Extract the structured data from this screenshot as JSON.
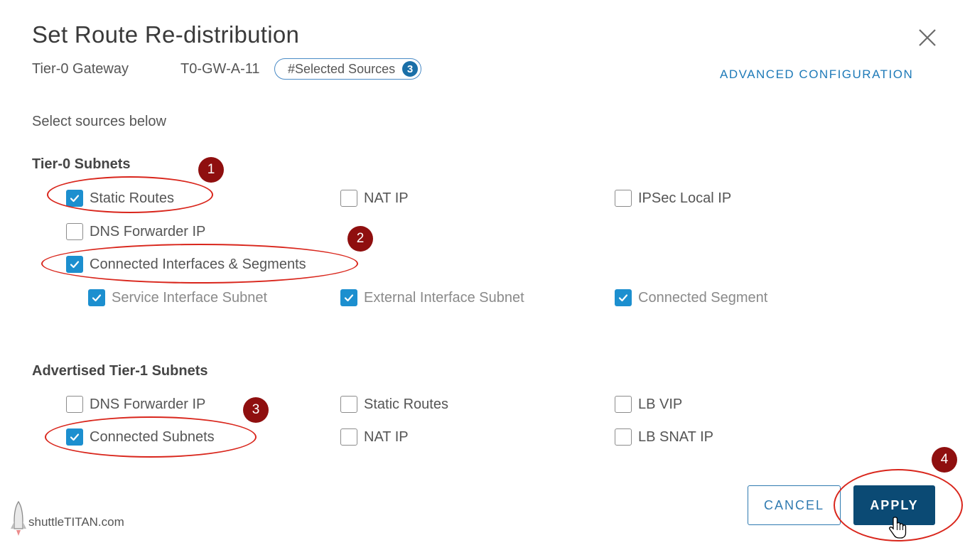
{
  "dialog": {
    "title": "Set Route Re-distribution",
    "gateway_label": "Tier-0 Gateway",
    "gateway_name": "T0-GW-A-11",
    "selected_sources_label": "#Selected Sources",
    "selected_sources_count": "3",
    "advanced_configuration": "ADVANCED CONFIGURATION",
    "hint": "Select sources below"
  },
  "tier0": {
    "heading": "Tier-0 Subnets",
    "static_routes": {
      "label": "Static Routes",
      "checked": true
    },
    "nat_ip": {
      "label": "NAT IP",
      "checked": false
    },
    "ipsec_local_ip": {
      "label": "IPSec Local IP",
      "checked": false
    },
    "dns_forwarder_ip": {
      "label": "DNS Forwarder IP",
      "checked": false
    },
    "connected_interfaces": {
      "label": "Connected Interfaces & Segments",
      "checked": true
    },
    "service_interface_subnet": {
      "label": "Service Interface Subnet",
      "checked": true
    },
    "external_interface_subnet": {
      "label": "External Interface Subnet",
      "checked": true
    },
    "connected_segment": {
      "label": "Connected Segment",
      "checked": true
    }
  },
  "tier1": {
    "heading": "Advertised Tier-1 Subnets",
    "dns_forwarder_ip": {
      "label": "DNS Forwarder IP",
      "checked": false
    },
    "static_routes": {
      "label": "Static Routes",
      "checked": false
    },
    "lb_vip": {
      "label": "LB VIP",
      "checked": false
    },
    "connected_subnets": {
      "label": "Connected Subnets",
      "checked": true
    },
    "nat_ip": {
      "label": "NAT IP",
      "checked": false
    },
    "lb_snat_ip": {
      "label": "LB SNAT IP",
      "checked": false
    }
  },
  "buttons": {
    "cancel": "CANCEL",
    "apply": "APPLY"
  },
  "annotations": {
    "marker_1": "1",
    "marker_2": "2",
    "marker_3": "3",
    "marker_4": "4",
    "color": "#d9261c",
    "marker_color": "#8f0f0f"
  },
  "watermark": "shuttleTITAN.com",
  "icons": {
    "close": "close-icon",
    "checkbox_checked": "checkmark-icon",
    "cursor": "hand-pointer-icon",
    "logo": "shuttle-logo-icon"
  },
  "colors": {
    "accent": "#1c8fcf",
    "primary_button": "#0b4a74",
    "link": "#1e7ab8"
  }
}
